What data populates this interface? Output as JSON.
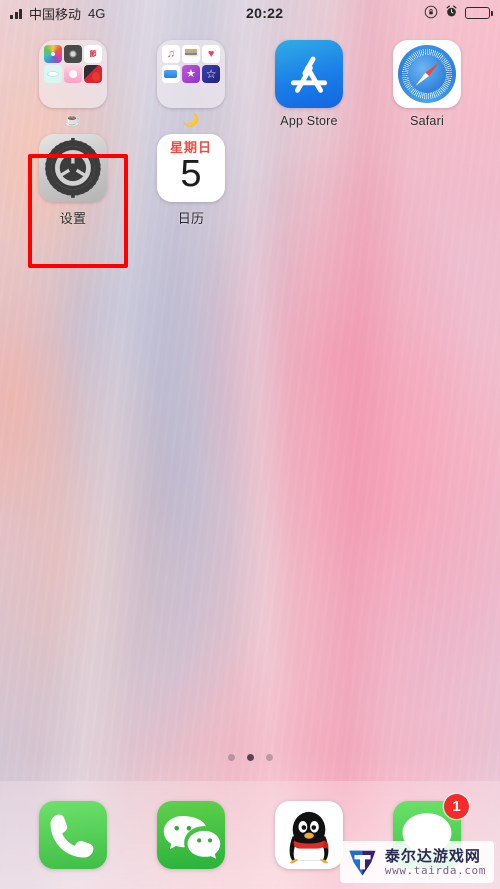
{
  "status_bar": {
    "signal_icon": "signal-bars-icon",
    "carrier": "中国移动",
    "network": "4G",
    "time": "20:22",
    "rotation_lock_icon": "rotation-lock-icon",
    "alarm_icon": "alarm-clock-icon",
    "battery_icon": "battery-full-icon"
  },
  "home": {
    "rows": [
      {
        "items": [
          {
            "type": "folder",
            "name": "folder-1",
            "label": "☕",
            "mini_icons": [
              "photos-icon",
              "camera-icon",
              "news-icon",
              "cyan-app-icon",
              "pink-camera-icon",
              "red-app-icon"
            ]
          },
          {
            "type": "folder",
            "name": "folder-2",
            "label": "🌙",
            "mini_icons": [
              "music-icon",
              "reminders-icon",
              "health-icon",
              "files-icon",
              "itunes-store-icon",
              "imovie-icon"
            ]
          },
          {
            "type": "app",
            "name": "app-store",
            "label": "App Store",
            "icon": "app-store-icon"
          },
          {
            "type": "app",
            "name": "safari",
            "label": "Safari",
            "icon": "safari-compass-icon"
          }
        ]
      },
      {
        "items": [
          {
            "type": "app",
            "name": "settings",
            "label": "设置",
            "icon": "settings-gears-icon",
            "selected": true
          },
          {
            "type": "app",
            "name": "calendar",
            "label": "日历",
            "icon": "calendar-icon",
            "day_of_week": "星期日",
            "day_number": "5"
          }
        ]
      }
    ]
  },
  "selection": {
    "color": "#fe0000",
    "target": "settings"
  },
  "page_dots": {
    "count": 3,
    "active_index": 1
  },
  "dock": {
    "items": [
      {
        "name": "phone",
        "icon": "phone-handset-icon",
        "badge": ""
      },
      {
        "name": "wechat",
        "icon": "wechat-bubbles-icon",
        "badge": ""
      },
      {
        "name": "qq",
        "icon": "qq-penguin-icon",
        "badge": ""
      },
      {
        "name": "messages",
        "icon": "messages-bubble-icon",
        "badge": "1"
      }
    ]
  },
  "watermark": {
    "logo": "tairda-logo-icon",
    "site_name": "泰尔达游戏网",
    "url": "www.tairda.com"
  }
}
